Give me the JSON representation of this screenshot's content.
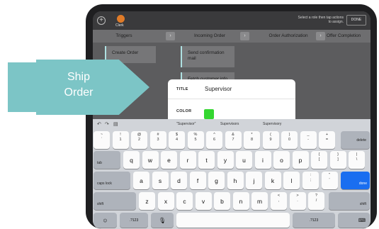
{
  "topbar": {
    "add_icon": "plus-circle-icon",
    "role_label": "Clerk",
    "role_color": "#e07b28",
    "hint": "Select a role then tap actions to assign.",
    "done_label": "DONE"
  },
  "columns": [
    "Triggers",
    "Incoming Order",
    "Order Authorization",
    "Offer Completion"
  ],
  "cards": {
    "create_order": "Create Order",
    "send_confirmation": "Send confirmation mail",
    "fetch_info": "Fetch customer info"
  },
  "popup": {
    "title_label": "TITLE",
    "title_value": "Supervisor",
    "color_label": "COLOR",
    "color_value": "#34d630"
  },
  "keyboard": {
    "suggestions": [
      "\"Supervisor\"",
      "Supervisors",
      "Supervisory"
    ],
    "row1": [
      {
        "top": "~",
        "bottom": "`"
      },
      {
        "top": "!",
        "bottom": "1"
      },
      {
        "top": "@",
        "bottom": "2"
      },
      {
        "top": "#",
        "bottom": "3"
      },
      {
        "top": "$",
        "bottom": "4"
      },
      {
        "top": "%",
        "bottom": "5"
      },
      {
        "top": "^",
        "bottom": "6"
      },
      {
        "top": "&",
        "bottom": "7"
      },
      {
        "top": "*",
        "bottom": "8"
      },
      {
        "top": "(",
        "bottom": "9"
      },
      {
        "top": ")",
        "bottom": "0"
      },
      {
        "top": "_",
        "bottom": "-"
      },
      {
        "top": "+",
        "bottom": "="
      }
    ],
    "delete_label": "delete",
    "tab_label": "tab",
    "row2": [
      "q",
      "w",
      "e",
      "r",
      "t",
      "y",
      "u",
      "i",
      "o",
      "p"
    ],
    "row2_extra": [
      {
        "top": "{",
        "bottom": "["
      },
      {
        "top": "}",
        "bottom": "]"
      },
      {
        "top": "|",
        "bottom": "\\"
      }
    ],
    "caps_label": "caps lock",
    "row3": [
      "a",
      "s",
      "d",
      "f",
      "g",
      "h",
      "j",
      "k",
      "l"
    ],
    "row3_extra": [
      {
        "top": ":",
        "bottom": ";"
      },
      {
        "top": "\"",
        "bottom": "'"
      }
    ],
    "done_label": "done",
    "shift_label": "shift",
    "row4": [
      "z",
      "x",
      "c",
      "v",
      "b",
      "n",
      "m"
    ],
    "row4_extra": [
      {
        "top": "<",
        "bottom": ","
      },
      {
        "top": ">",
        "bottom": "."
      },
      {
        "top": "?",
        "bottom": "/"
      }
    ],
    "numbers_label": ".?123",
    "accent_color": "#1a6ef0"
  },
  "overlay": {
    "label_line1": "Ship",
    "label_line2": "Order"
  }
}
